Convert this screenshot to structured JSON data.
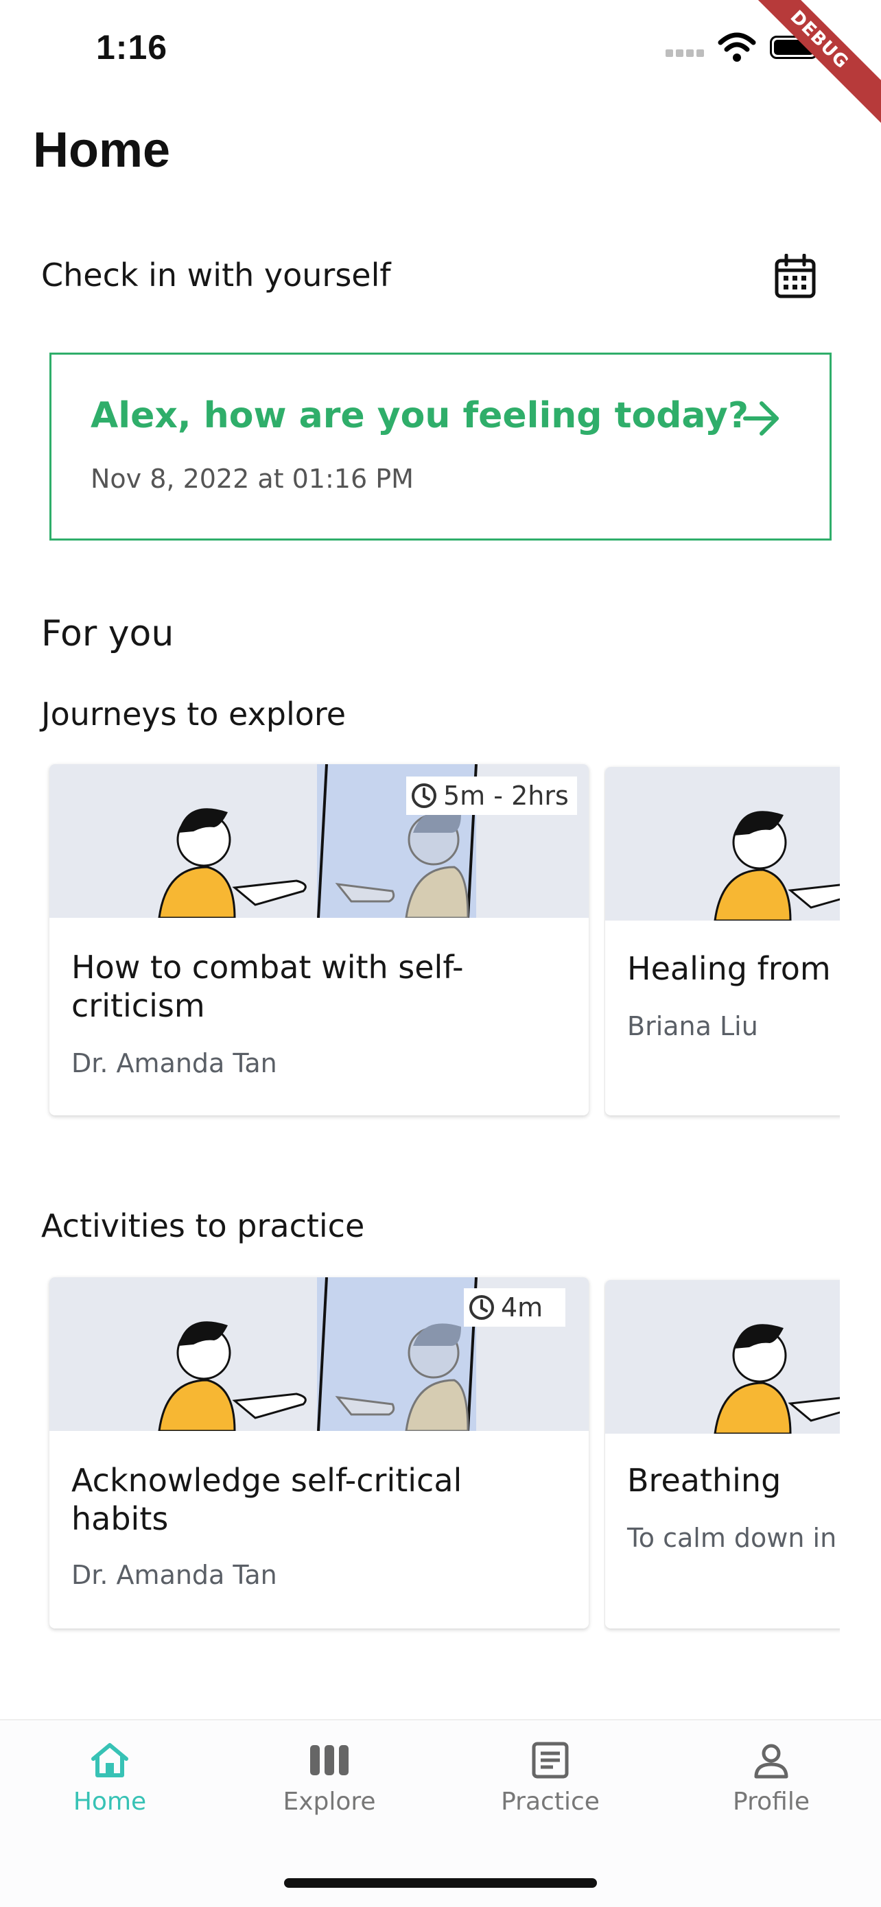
{
  "status_bar": {
    "time": "1:16"
  },
  "debug_banner": "DEBUG",
  "header": {
    "title": "Home"
  },
  "check_in": {
    "heading": "Check in with yourself",
    "question": "Alex, how are you feeling today?",
    "date": "Nov 8, 2022 at 01:16 PM"
  },
  "for_you": {
    "heading": "For you",
    "journeys": {
      "heading": "Journeys to explore",
      "cards": [
        {
          "title": "How to combat with self-criticism",
          "author": "Dr. Amanda Tan",
          "duration": "5m - 2hrs"
        },
        {
          "title": "Healing from",
          "author": "Briana Liu"
        }
      ]
    },
    "activities": {
      "heading": "Activities to practice",
      "cards": [
        {
          "title": "Acknowledge self-critical habits",
          "author": "Dr. Amanda Tan",
          "duration": "4m"
        },
        {
          "title": "Breathing",
          "author": "To calm down in a"
        }
      ]
    }
  },
  "bottom_nav": {
    "items": [
      {
        "label": "Home",
        "icon": "home-icon",
        "active": true
      },
      {
        "label": "Explore",
        "icon": "explore-icon",
        "active": false
      },
      {
        "label": "Practice",
        "icon": "practice-icon",
        "active": false
      },
      {
        "label": "Profile",
        "icon": "profile-icon",
        "active": false
      }
    ]
  },
  "colors": {
    "accent_green": "#2fae6a",
    "nav_active": "#37c2b5",
    "debug_red": "#b73a3a"
  }
}
